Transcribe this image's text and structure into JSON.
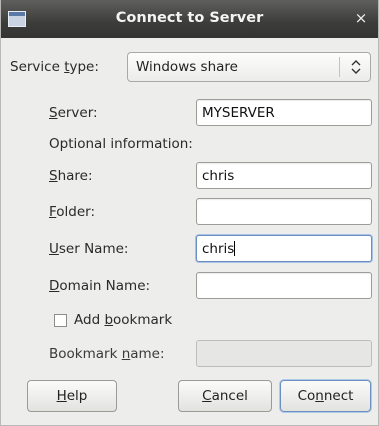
{
  "window": {
    "title": "Connect to Server",
    "close_glyph": "×",
    "icon": "window-icon"
  },
  "service_type": {
    "label_pre": "Service ",
    "label_u": "t",
    "label_post": "ype:",
    "value": "Windows share",
    "arrow": "⌃⌄"
  },
  "server": {
    "label_u": "S",
    "label_post": "erver:",
    "value": "MYSERVER"
  },
  "optional_heading": "Optional information:",
  "share": {
    "label_u": "S",
    "label_post": "hare:",
    "value": "chris"
  },
  "folder": {
    "label_u": "F",
    "label_post": "older:",
    "value": ""
  },
  "user_name": {
    "label_u": "U",
    "label_post": "ser Name:",
    "value": "chris"
  },
  "domain_name": {
    "label_u": "D",
    "label_post": "omain Name:",
    "value": ""
  },
  "bookmark": {
    "checkbox_pre": "Add ",
    "checkbox_u": "b",
    "checkbox_post": "ookmark",
    "checked": false,
    "name_label_pre": "Bookmark ",
    "name_label_u": "n",
    "name_label_post": "ame:",
    "name_value": ""
  },
  "buttons": {
    "help": {
      "u": "H",
      "post": "elp"
    },
    "cancel": {
      "u": "C",
      "post": "ancel"
    },
    "connect": {
      "pre": "Co",
      "u": "n",
      "post": "nect"
    }
  }
}
